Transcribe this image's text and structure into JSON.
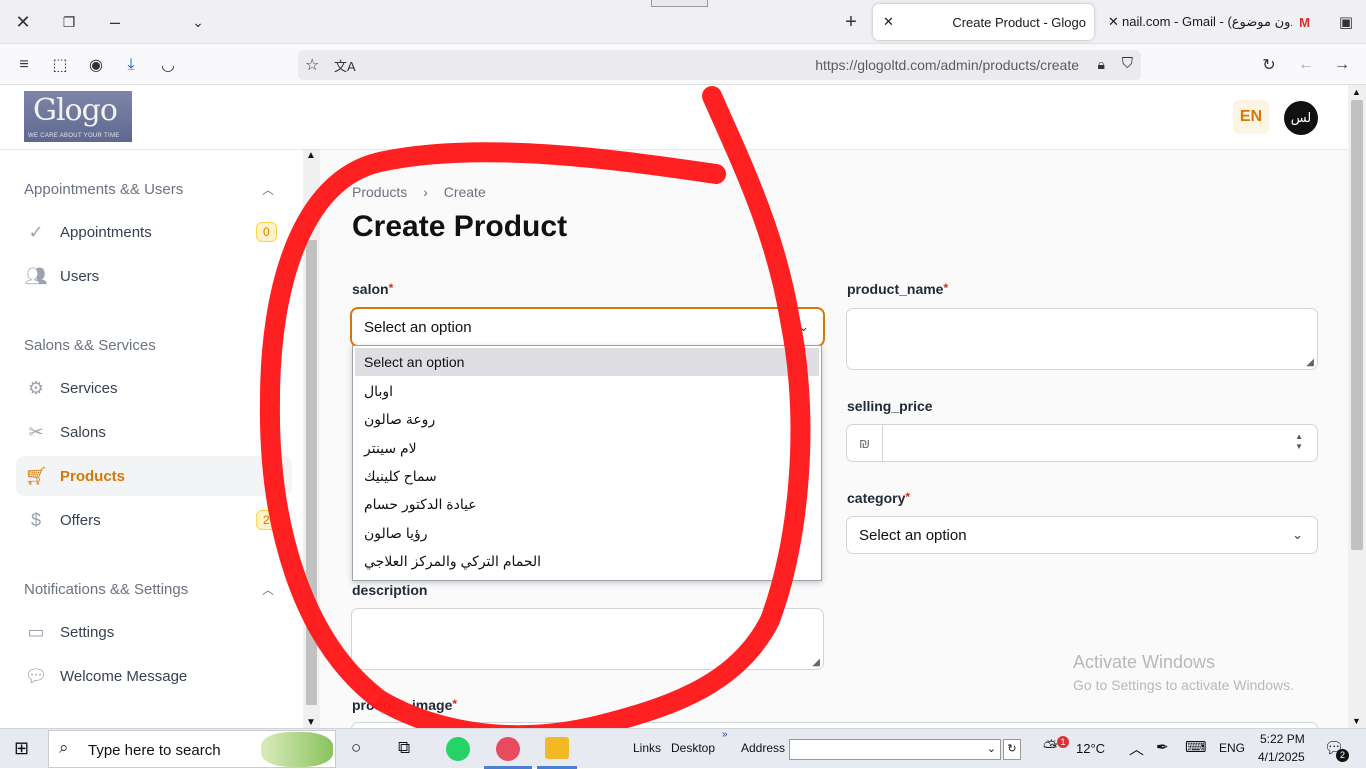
{
  "browser": {
    "tabs": [
      {
        "title": "Create Product - Glogo",
        "active": true
      },
      {
        "title": "nail.com - Gmail - (بدون موضوع)",
        "active": false
      }
    ],
    "url": "https://glogoltd.com/admin/products/create"
  },
  "header": {
    "logo_text": "Glogo",
    "logo_tagline": "WE CARE ABOUT YOUR TIME",
    "lang_button": "EN",
    "avatar_initials": "لس"
  },
  "sidebar": {
    "groups": [
      {
        "title": "Appointments && Users",
        "items": [
          {
            "label": "Appointments",
            "icon": "check-circle-icon",
            "badge": "0"
          },
          {
            "label": "Users",
            "icon": "users-icon"
          }
        ]
      },
      {
        "title": "Salons && Services",
        "items": [
          {
            "label": "Services",
            "icon": "gear-icon"
          },
          {
            "label": "Salons",
            "icon": "scissors-icon"
          },
          {
            "label": "Products",
            "icon": "cart-icon",
            "active": true
          },
          {
            "label": "Offers",
            "icon": "dollar-icon",
            "badge": "2"
          }
        ]
      },
      {
        "title": "Notifications && Settings",
        "items": [
          {
            "label": "Settings",
            "icon": "stack-icon"
          },
          {
            "label": "Welcome Message",
            "icon": "message-icon"
          }
        ]
      }
    ]
  },
  "main": {
    "breadcrumb": [
      "Products",
      "Create"
    ],
    "title": "Create Product",
    "fields": {
      "salon": {
        "label": "salon",
        "required": true,
        "value": "Select an option"
      },
      "product_name": {
        "label": "product_name",
        "required": true,
        "value": ""
      },
      "selling_price": {
        "label": "selling_price",
        "prefix": "₪",
        "value": ""
      },
      "category": {
        "label": "category",
        "required": true,
        "value": "Select an option"
      },
      "description": {
        "label": "description",
        "value": ""
      },
      "product_image": {
        "label": "product_image",
        "required": true
      }
    },
    "salon_options": [
      "Select an option",
      "اوبال",
      "روعة صالون",
      "لام سينتر",
      "سماح كلينيك",
      "عيادة الدكتور حسام",
      "رؤيا صالون",
      "الحمام التركي والمركز العلاجي"
    ]
  },
  "watermark": {
    "line1": "Activate Windows",
    "line2": "Go to Settings to activate Windows."
  },
  "taskbar": {
    "search_placeholder": "Type here to search",
    "links": "Links",
    "desktop": "Desktop",
    "address": "Address",
    "temperature": "12°C",
    "weather_badge": "1",
    "language": "ENG",
    "time": "5:22 PM",
    "date": "4/1/2025",
    "notification_count": "2"
  },
  "colors": {
    "accent": "#d97706",
    "annotation": "#ff1a1a"
  }
}
